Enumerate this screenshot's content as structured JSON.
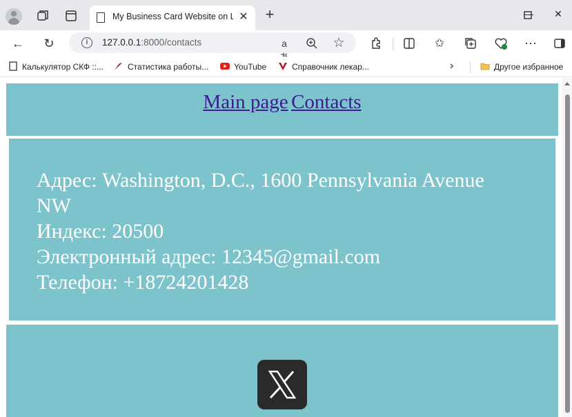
{
  "browser": {
    "tab_title": "My Business Card Website on Lara",
    "url_host": "127.0.0.1",
    "url_path": ":8000/contacts"
  },
  "bookmarks": [
    {
      "label": "Калькулятор СКФ ::..."
    },
    {
      "label": "Статистика работы..."
    },
    {
      "label": "YouTube"
    },
    {
      "label": "Справочник лекар..."
    }
  ],
  "bookmarks_folder": "Другое избранное",
  "nav": {
    "main_page": "Main page",
    "contacts": "Contacts"
  },
  "contacts": {
    "address_line1": "Адрес: Washington, D.C., 1600 Pennsylvania Avenue",
    "address_line2": "NW",
    "index": "Индекс: 20500",
    "email": "Электронный адрес: 12345@gmail.com",
    "phone": "Телефон: +18724201428"
  },
  "colors": {
    "panel": "#7cc3cc",
    "link": "#3b1e8e",
    "text": "#ffffff"
  },
  "social": {
    "icon": "x-logo-icon"
  }
}
